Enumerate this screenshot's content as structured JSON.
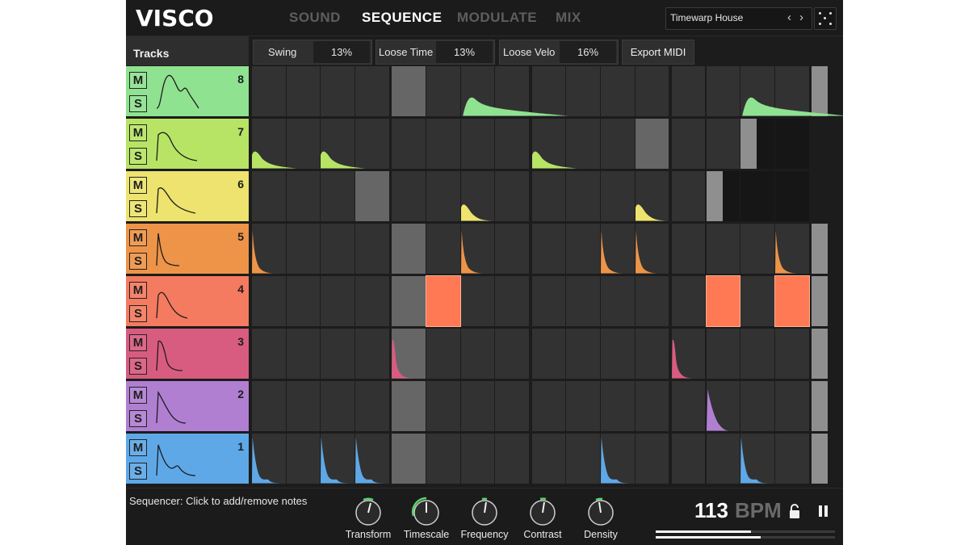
{
  "app": {
    "title": "VISCO"
  },
  "nav": {
    "tabs": [
      "SOUND",
      "SEQUENCE",
      "MODULATE",
      "MIX"
    ],
    "active": "SEQUENCE"
  },
  "preset": {
    "name": "Timewarp House",
    "prev_icon": "chevron-left-icon",
    "next_icon": "chevron-right-icon"
  },
  "randomize": {
    "icon": "dice-icon"
  },
  "tracks_header": "Tracks",
  "params": [
    {
      "label": "Swing",
      "value": "13%"
    },
    {
      "label": "Loose Time",
      "value": "13%"
    },
    {
      "label": "Loose Velo",
      "value": "16%"
    }
  ],
  "export_label": "Export MIDI",
  "tracks": [
    {
      "number": "8",
      "color": "#8fe290",
      "mute": "M",
      "solo": "S"
    },
    {
      "number": "7",
      "color": "#b7e465",
      "mute": "M",
      "solo": "S"
    },
    {
      "number": "6",
      "color": "#ede36e",
      "mute": "M",
      "solo": "S"
    },
    {
      "number": "5",
      "color": "#ee9448",
      "mute": "M",
      "solo": "S"
    },
    {
      "number": "4",
      "color": "#f47a60",
      "mute": "M",
      "solo": "S"
    },
    {
      "number": "3",
      "color": "#d85c80",
      "mute": "M",
      "solo": "S"
    },
    {
      "number": "2",
      "color": "#b07fd2",
      "mute": "M",
      "solo": "S"
    },
    {
      "number": "1",
      "color": "#5ea8e8",
      "mute": "M",
      "solo": "S"
    }
  ],
  "sequence": {
    "steps": 16,
    "notes": {
      "8": [
        6,
        14
      ],
      "7": [
        0,
        2,
        8
      ],
      "6": [
        6,
        11
      ],
      "5": [
        0,
        6,
        10,
        11,
        15
      ],
      "4": [
        5,
        13,
        15
      ],
      "3": [
        4,
        12
      ],
      "2": [
        13
      ],
      "1": [
        0,
        2,
        3,
        10,
        14
      ]
    },
    "track_lengths": {
      "8": 16,
      "7": 14,
      "6": 13,
      "5": 16,
      "4": 16,
      "3": 16,
      "2": 16,
      "1": 16
    },
    "playhead_steps": {
      "8": 4,
      "7": 11,
      "6": 3,
      "5": 4,
      "4": 4,
      "3": 4,
      "2": 4,
      "1": 4
    }
  },
  "footer": {
    "status": "Sequencer: Click to add/remove notes",
    "knobs": [
      {
        "label": "Transform"
      },
      {
        "label": "Timescale"
      },
      {
        "label": "Frequency"
      },
      {
        "label": "Contrast"
      },
      {
        "label": "Density"
      }
    ],
    "bpm": "113",
    "bpm_unit": "BPM",
    "lock_icon": "lock-icon",
    "pause_icon": "pause-icon"
  }
}
